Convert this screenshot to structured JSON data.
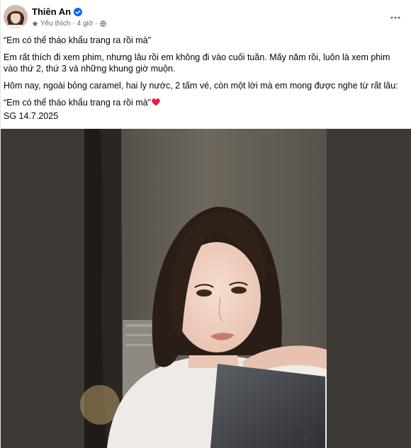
{
  "post": {
    "author": {
      "name": "Thiên An",
      "verified": true,
      "avatar_icon": "profile-avatar"
    },
    "meta": {
      "badge_label": "Yêu thích",
      "separator": "·",
      "time": "4 giờ",
      "separator2": "·",
      "audience_icon": "globe-icon"
    },
    "more_icon": "ellipsis-icon",
    "content": {
      "quote_title": "“Em có thể tháo khẩu trang ra rồi mà”",
      "paragraph_1": "Em rất thích đi xem phim, nhưng lâu rồi em không đi vào cuối tuần. Mấy năm rồi, luôn là xem phim vào thứ 2, thứ 3 và những khung giờ muộn.",
      "paragraph_2": "Hôm nay, ngoài bỏng caramel, hai ly nước, 2 tấm vé, còn một lời mà em mong được nghe từ rất lâu:",
      "quote_repeat": "“Em có thể tháo khẩu trang ra rồi mà”",
      "signature": "SG 14.7.2025"
    },
    "photo": {
      "subject": "selfie-photo"
    },
    "colors": {
      "verified_blue": "#0866ff",
      "heart_red": "#e41e3f",
      "meta_gray": "#65676b"
    }
  }
}
